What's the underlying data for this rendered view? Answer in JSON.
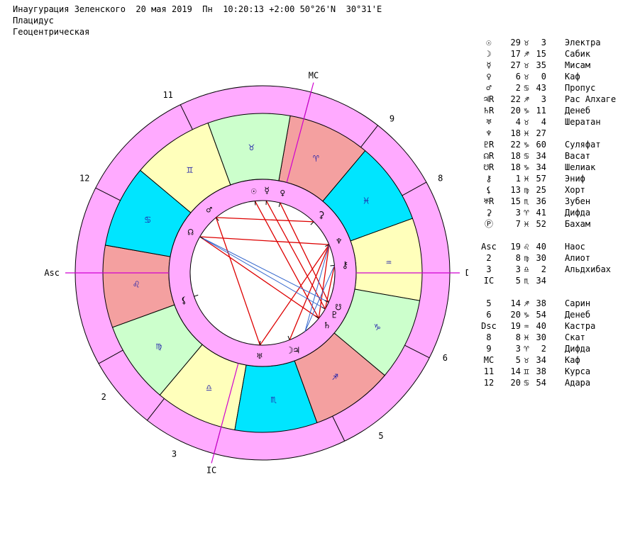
{
  "header": {
    "line1": "Инаугурация Зеленского  20 мая 2019  Пн  10:20:13 +2:00 50°26'N  30°31'E",
    "line2": "Плацидус",
    "line3": "Геоцентрическая"
  },
  "colors": {
    "outer_ring": "#ffaaff",
    "fire": "#f4a0a0",
    "earth": "#ccffcc",
    "air": "#ffffbb",
    "water": "#00e5ff",
    "axis": "#d000d0",
    "aspect_red": "#dd0000",
    "aspect_blue": "#3366cc"
  },
  "chart": {
    "axes": {
      "mc": "MC",
      "ic": "IC",
      "asc": "Asc",
      "dsc": "Dsc"
    },
    "house_labels": [
      {
        "n": "2",
        "deg": 218
      },
      {
        "n": "3",
        "deg": 244
      },
      {
        "n": "5",
        "deg": 306
      },
      {
        "n": "6",
        "deg": 335
      },
      {
        "n": "8",
        "deg": 28
      },
      {
        "n": "9",
        "deg": 50
      },
      {
        "n": "11",
        "deg": 118
      },
      {
        "n": "12",
        "deg": 152
      }
    ],
    "house_cusps_deg": [
      0,
      29,
      52,
      75,
      116,
      153,
      180,
      209,
      232,
      255,
      296,
      333
    ],
    "signs": [
      {
        "glyph": "♌",
        "name": "leo",
        "start": 170,
        "element": "fire"
      },
      {
        "glyph": "♍",
        "name": "virgo",
        "start": 200,
        "element": "earth"
      },
      {
        "glyph": "♎",
        "name": "libra",
        "start": 230,
        "element": "air"
      },
      {
        "glyph": "♏",
        "name": "scorpio",
        "start": 260,
        "element": "water"
      },
      {
        "glyph": "♐",
        "name": "sagittarius",
        "start": 290,
        "element": "fire"
      },
      {
        "glyph": "♑",
        "name": "capricorn",
        "start": 320,
        "element": "earth"
      },
      {
        "glyph": "♒",
        "name": "aquarius",
        "start": 350,
        "element": "air"
      },
      {
        "glyph": "♓",
        "name": "pisces",
        "start": 20,
        "element": "water"
      },
      {
        "glyph": "♈",
        "name": "aries",
        "start": 50,
        "element": "fire"
      },
      {
        "glyph": "♉",
        "name": "taurus",
        "start": 80,
        "element": "earth"
      },
      {
        "glyph": "♊",
        "name": "gemini",
        "start": 110,
        "element": "air"
      },
      {
        "glyph": "♋",
        "name": "cancer",
        "start": 140,
        "element": "water"
      }
    ],
    "planets": [
      {
        "glyph": "☉",
        "name": "sun",
        "deg": 96
      },
      {
        "glyph": "☿",
        "name": "mercury",
        "deg": 87
      },
      {
        "glyph": "♀",
        "name": "venus",
        "deg": 76
      },
      {
        "glyph": "♂",
        "name": "mars",
        "deg": 130
      },
      {
        "glyph": "☊",
        "name": "north-node",
        "deg": 150
      },
      {
        "glyph": "⚸",
        "name": "lilith",
        "deg": 199
      },
      {
        "glyph": "♅",
        "name": "uranus",
        "deg": 268
      },
      {
        "glyph": "☽♃",
        "name": "moon-jupiter",
        "deg": 292
      },
      {
        "glyph": "♄",
        "name": "saturn",
        "deg": 321
      },
      {
        "glyph": "♇",
        "name": "pluto",
        "deg": 330
      },
      {
        "glyph": "☋",
        "name": "south-node",
        "deg": 336
      },
      {
        "glyph": "⚷",
        "name": "chiron",
        "deg": 6
      },
      {
        "glyph": "♆",
        "name": "neptune",
        "deg": 23
      },
      {
        "glyph": "⚳",
        "name": "ceres",
        "deg": 45
      }
    ]
  },
  "positions": [
    {
      "sym": "☉",
      "deg": "29",
      "sign": "♉",
      "min": "3",
      "star": "Электра"
    },
    {
      "sym": "☽",
      "deg": "17",
      "sign": "♐",
      "min": "15",
      "star": "Сабик"
    },
    {
      "sym": "☿",
      "deg": "27",
      "sign": "♉",
      "min": "35",
      "star": "Мисам"
    },
    {
      "sym": "♀",
      "deg": "6",
      "sign": "♉",
      "min": "0",
      "star": "Каф"
    },
    {
      "sym": "♂",
      "deg": "2",
      "sign": "♋",
      "min": "43",
      "star": "Пропус"
    },
    {
      "sym": "♃R",
      "deg": "22",
      "sign": "♐",
      "min": "3",
      "star": "Рас Алхаге"
    },
    {
      "sym": "♄R",
      "deg": "20",
      "sign": "♑",
      "min": "11",
      "star": "Денеб"
    },
    {
      "sym": "♅",
      "deg": "4",
      "sign": "♉",
      "min": "4",
      "star": "Шератан"
    },
    {
      "sym": "♆",
      "deg": "18",
      "sign": "♓",
      "min": "27",
      "star": ""
    },
    {
      "sym": "♇R",
      "deg": "22",
      "sign": "♑",
      "min": "60",
      "star": "Суляфат"
    },
    {
      "sym": "☊R",
      "deg": "18",
      "sign": "♋",
      "min": "34",
      "star": "Васат"
    },
    {
      "sym": "☋R",
      "deg": "18",
      "sign": "♑",
      "min": "34",
      "star": "Шелиак"
    },
    {
      "sym": "⚷",
      "deg": "1",
      "sign": "♓",
      "min": "57",
      "star": "Эниф"
    },
    {
      "sym": "⚸",
      "deg": "13",
      "sign": "♍",
      "min": "25",
      "star": "Хорт"
    },
    {
      "sym": "♅R",
      "deg": "15",
      "sign": "♏",
      "min": "36",
      "star": "Зубен"
    },
    {
      "sym": "⚳",
      "deg": "3",
      "sign": "♈",
      "min": "41",
      "star": "Дифда"
    },
    {
      "sym": "Ⓟ",
      "deg": "7",
      "sign": "♓",
      "min": "52",
      "star": "Бахам"
    },
    {
      "sym": "Asc",
      "deg": "19",
      "sign": "♌",
      "min": "40",
      "star": "Наос"
    },
    {
      "sym": "2",
      "deg": "8",
      "sign": "♍",
      "min": "30",
      "star": "Алиот"
    },
    {
      "sym": "3",
      "deg": "3",
      "sign": "♎",
      "min": "2",
      "star": "Альдхибах"
    },
    {
      "sym": "IC",
      "deg": "5",
      "sign": "♏",
      "min": "34",
      "star": ""
    },
    {
      "sym": "5",
      "deg": "14",
      "sign": "♐",
      "min": "38",
      "star": "Сарин"
    },
    {
      "sym": "6",
      "deg": "20",
      "sign": "♑",
      "min": "54",
      "star": "Денеб"
    },
    {
      "sym": "Dsc",
      "deg": "19",
      "sign": "♒",
      "min": "40",
      "star": "Кастра"
    },
    {
      "sym": "8",
      "deg": "8",
      "sign": "♓",
      "min": "30",
      "star": "Скат"
    },
    {
      "sym": "9",
      "deg": "3",
      "sign": "♈",
      "min": "2",
      "star": "Дифда"
    },
    {
      "sym": "MC",
      "deg": "5",
      "sign": "♉",
      "min": "34",
      "star": "Каф"
    },
    {
      "sym": "11",
      "deg": "14",
      "sign": "♊",
      "min": "38",
      "star": "Курса"
    },
    {
      "sym": "12",
      "deg": "20",
      "sign": "♋",
      "min": "54",
      "star": "Адара"
    }
  ]
}
